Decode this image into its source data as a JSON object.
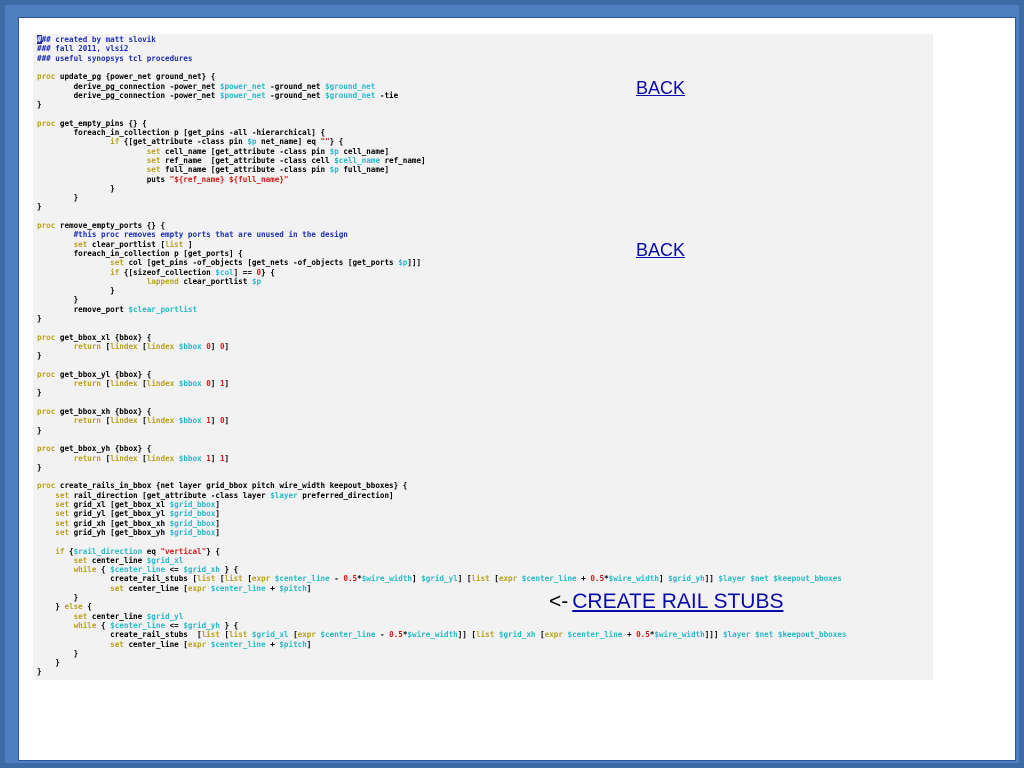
{
  "code": [
    [
      {
        "t": "#",
        "cls": "cursor"
      },
      {
        "t": "## created by matt slovik",
        "cls": "c"
      }
    ],
    [
      {
        "t": "### fall 2011, vlsi2",
        "cls": "c"
      }
    ],
    [
      {
        "t": "### useful synopsys tcl procedures",
        "cls": "c"
      }
    ],
    [],
    [
      {
        "t": "proc",
        "cls": "k"
      },
      {
        "t": " update_pg {power_net ground_net} {"
      }
    ],
    [
      {
        "t": "        derive_pg_connection -power_net "
      },
      {
        "t": "$power_net",
        "cls": "v"
      },
      {
        "t": " -ground_net "
      },
      {
        "t": "$ground_net",
        "cls": "v"
      }
    ],
    [
      {
        "t": "        derive_pg_connection -power_net "
      },
      {
        "t": "$power_net",
        "cls": "v"
      },
      {
        "t": " -ground_net "
      },
      {
        "t": "$ground_net",
        "cls": "v"
      },
      {
        "t": " -tie"
      }
    ],
    [
      {
        "t": "}"
      }
    ],
    [],
    [
      {
        "t": "proc",
        "cls": "k"
      },
      {
        "t": " get_empty_pins {} {"
      }
    ],
    [
      {
        "t": "        foreach_in_collection p [get_pins -all -hierarchical] {"
      }
    ],
    [
      {
        "t": "                "
      },
      {
        "t": "if",
        "cls": "k"
      },
      {
        "t": " {[get_attribute -class pin "
      },
      {
        "t": "$p",
        "cls": "v"
      },
      {
        "t": " net_name] eq "
      },
      {
        "t": "\"\"",
        "cls": "s"
      },
      {
        "t": "} {"
      }
    ],
    [
      {
        "t": "                        "
      },
      {
        "t": "set",
        "cls": "k"
      },
      {
        "t": " cell_name [get_attribute -class pin "
      },
      {
        "t": "$p",
        "cls": "v"
      },
      {
        "t": " cell_name]"
      }
    ],
    [
      {
        "t": "                        "
      },
      {
        "t": "set",
        "cls": "k"
      },
      {
        "t": " ref_name  [get_attribute -class cell "
      },
      {
        "t": "$cell_name",
        "cls": "v"
      },
      {
        "t": " ref_name]"
      }
    ],
    [
      {
        "t": "                        "
      },
      {
        "t": "set",
        "cls": "k"
      },
      {
        "t": " full_name [get_attribute -class pin "
      },
      {
        "t": "$p",
        "cls": "v"
      },
      {
        "t": " full_name]"
      }
    ],
    [
      {
        "t": "                        puts "
      },
      {
        "t": "\"${ref_name} ${full_name}\"",
        "cls": "s"
      }
    ],
    [
      {
        "t": "                }"
      }
    ],
    [
      {
        "t": "        }"
      }
    ],
    [
      {
        "t": "}"
      }
    ],
    [],
    [
      {
        "t": "proc",
        "cls": "k"
      },
      {
        "t": " remove_empty_ports {} {"
      }
    ],
    [
      {
        "t": "        #this proc removes empty ports that are unused in the design",
        "cls": "c"
      }
    ],
    [
      {
        "t": "        "
      },
      {
        "t": "set",
        "cls": "k"
      },
      {
        "t": " clear_portlist ["
      },
      {
        "t": "list",
        "cls": "k"
      },
      {
        "t": " ]"
      }
    ],
    [
      {
        "t": "        foreach_in_collection p [get_ports] {"
      }
    ],
    [
      {
        "t": "                "
      },
      {
        "t": "set",
        "cls": "k"
      },
      {
        "t": " col [get_pins -of_objects [get_nets -of_objects [get_ports "
      },
      {
        "t": "$p",
        "cls": "v"
      },
      {
        "t": "]]]"
      }
    ],
    [
      {
        "t": "                "
      },
      {
        "t": "if",
        "cls": "k"
      },
      {
        "t": " {[sizeof_collection "
      },
      {
        "t": "$col",
        "cls": "v"
      },
      {
        "t": "] == "
      },
      {
        "t": "0",
        "cls": "n"
      },
      {
        "t": "} {"
      }
    ],
    [
      {
        "t": "                        "
      },
      {
        "t": "lappend",
        "cls": "k"
      },
      {
        "t": " clear_portlist "
      },
      {
        "t": "$p",
        "cls": "v"
      }
    ],
    [
      {
        "t": "                }"
      }
    ],
    [
      {
        "t": "        }"
      }
    ],
    [
      {
        "t": "        remove_port "
      },
      {
        "t": "$clear_portlist",
        "cls": "v"
      }
    ],
    [
      {
        "t": "}"
      }
    ],
    [],
    [
      {
        "t": "proc",
        "cls": "k"
      },
      {
        "t": " get_bbox_xl {bbox} {"
      }
    ],
    [
      {
        "t": "        "
      },
      {
        "t": "return",
        "cls": "k"
      },
      {
        "t": " ["
      },
      {
        "t": "lindex",
        "cls": "k"
      },
      {
        "t": " ["
      },
      {
        "t": "lindex",
        "cls": "k"
      },
      {
        "t": " "
      },
      {
        "t": "$bbox",
        "cls": "v"
      },
      {
        "t": " "
      },
      {
        "t": "0",
        "cls": "n"
      },
      {
        "t": "] "
      },
      {
        "t": "0",
        "cls": "n"
      },
      {
        "t": "]"
      }
    ],
    [
      {
        "t": "}"
      }
    ],
    [],
    [
      {
        "t": "proc",
        "cls": "k"
      },
      {
        "t": " get_bbox_yl {bbox} {"
      }
    ],
    [
      {
        "t": "        "
      },
      {
        "t": "return",
        "cls": "k"
      },
      {
        "t": " ["
      },
      {
        "t": "lindex",
        "cls": "k"
      },
      {
        "t": " ["
      },
      {
        "t": "lindex",
        "cls": "k"
      },
      {
        "t": " "
      },
      {
        "t": "$bbox",
        "cls": "v"
      },
      {
        "t": " "
      },
      {
        "t": "0",
        "cls": "n"
      },
      {
        "t": "] "
      },
      {
        "t": "1",
        "cls": "n"
      },
      {
        "t": "]"
      }
    ],
    [
      {
        "t": "}"
      }
    ],
    [],
    [
      {
        "t": "proc",
        "cls": "k"
      },
      {
        "t": " get_bbox_xh {bbox} {"
      }
    ],
    [
      {
        "t": "        "
      },
      {
        "t": "return",
        "cls": "k"
      },
      {
        "t": " ["
      },
      {
        "t": "lindex",
        "cls": "k"
      },
      {
        "t": " ["
      },
      {
        "t": "lindex",
        "cls": "k"
      },
      {
        "t": " "
      },
      {
        "t": "$bbox",
        "cls": "v"
      },
      {
        "t": " "
      },
      {
        "t": "1",
        "cls": "n"
      },
      {
        "t": "] "
      },
      {
        "t": "0",
        "cls": "n"
      },
      {
        "t": "]"
      }
    ],
    [
      {
        "t": "}"
      }
    ],
    [],
    [
      {
        "t": "proc",
        "cls": "k"
      },
      {
        "t": " get_bbox_yh {bbox} {"
      }
    ],
    [
      {
        "t": "        "
      },
      {
        "t": "return",
        "cls": "k"
      },
      {
        "t": " ["
      },
      {
        "t": "lindex",
        "cls": "k"
      },
      {
        "t": " ["
      },
      {
        "t": "lindex",
        "cls": "k"
      },
      {
        "t": " "
      },
      {
        "t": "$bbox",
        "cls": "v"
      },
      {
        "t": " "
      },
      {
        "t": "1",
        "cls": "n"
      },
      {
        "t": "] "
      },
      {
        "t": "1",
        "cls": "n"
      },
      {
        "t": "]"
      }
    ],
    [
      {
        "t": "}"
      }
    ],
    [],
    [
      {
        "t": "proc",
        "cls": "k"
      },
      {
        "t": " create_rails_in_bbox {net layer grid_bbox pitch wire_width keepout_bboxes} {"
      }
    ],
    [
      {
        "t": "    "
      },
      {
        "t": "set",
        "cls": "k"
      },
      {
        "t": " rail_direction [get_attribute -class layer "
      },
      {
        "t": "$layer",
        "cls": "v"
      },
      {
        "t": " preferred_direction]"
      }
    ],
    [
      {
        "t": "    "
      },
      {
        "t": "set",
        "cls": "k"
      },
      {
        "t": " grid_xl [get_bbox_xl "
      },
      {
        "t": "$grid_bbox",
        "cls": "v"
      },
      {
        "t": "]"
      }
    ],
    [
      {
        "t": "    "
      },
      {
        "t": "set",
        "cls": "k"
      },
      {
        "t": " grid_yl [get_bbox_yl "
      },
      {
        "t": "$grid_bbox",
        "cls": "v"
      },
      {
        "t": "]"
      }
    ],
    [
      {
        "t": "    "
      },
      {
        "t": "set",
        "cls": "k"
      },
      {
        "t": " grid_xh [get_bbox_xh "
      },
      {
        "t": "$grid_bbox",
        "cls": "v"
      },
      {
        "t": "]"
      }
    ],
    [
      {
        "t": "    "
      },
      {
        "t": "set",
        "cls": "k"
      },
      {
        "t": " grid_yh [get_bbox_yh "
      },
      {
        "t": "$grid_bbox",
        "cls": "v"
      },
      {
        "t": "]"
      }
    ],
    [],
    [
      {
        "t": "    "
      },
      {
        "t": "if",
        "cls": "k"
      },
      {
        "t": " {"
      },
      {
        "t": "$rail_direction",
        "cls": "v"
      },
      {
        "t": " eq "
      },
      {
        "t": "\"vertical\"",
        "cls": "s"
      },
      {
        "t": "} {"
      }
    ],
    [
      {
        "t": "        "
      },
      {
        "t": "set",
        "cls": "k"
      },
      {
        "t": " center_line "
      },
      {
        "t": "$grid_xl",
        "cls": "v"
      }
    ],
    [
      {
        "t": "        "
      },
      {
        "t": "while",
        "cls": "k"
      },
      {
        "t": " { "
      },
      {
        "t": "$center_line",
        "cls": "v"
      },
      {
        "t": " <= "
      },
      {
        "t": "$grid_xh",
        "cls": "v"
      },
      {
        "t": " } {"
      }
    ],
    [
      {
        "t": "                create_rail_stubs ["
      },
      {
        "t": "list",
        "cls": "k"
      },
      {
        "t": " ["
      },
      {
        "t": "list",
        "cls": "k"
      },
      {
        "t": " ["
      },
      {
        "t": "expr",
        "cls": "k"
      },
      {
        "t": " "
      },
      {
        "t": "$center_line",
        "cls": "v"
      },
      {
        "t": " - "
      },
      {
        "t": "0.5",
        "cls": "n"
      },
      {
        "t": "*"
      },
      {
        "t": "$wire_width",
        "cls": "v"
      },
      {
        "t": "] "
      },
      {
        "t": "$grid_yl",
        "cls": "v"
      },
      {
        "t": "] ["
      },
      {
        "t": "list",
        "cls": "k"
      },
      {
        "t": " ["
      },
      {
        "t": "expr",
        "cls": "k"
      },
      {
        "t": " "
      },
      {
        "t": "$center_line",
        "cls": "v"
      },
      {
        "t": " + "
      },
      {
        "t": "0.5",
        "cls": "n"
      },
      {
        "t": "*"
      },
      {
        "t": "$wire_width",
        "cls": "v"
      },
      {
        "t": "] "
      },
      {
        "t": "$grid_yh",
        "cls": "v"
      },
      {
        "t": "]] "
      },
      {
        "t": "$layer",
        "cls": "v"
      },
      {
        "t": " "
      },
      {
        "t": "$net",
        "cls": "v"
      },
      {
        "t": " "
      },
      {
        "t": "$keepout_bboxes",
        "cls": "v"
      }
    ],
    [
      {
        "t": "                "
      },
      {
        "t": "set",
        "cls": "k"
      },
      {
        "t": " center_line ["
      },
      {
        "t": "expr",
        "cls": "k"
      },
      {
        "t": " "
      },
      {
        "t": "$center_line",
        "cls": "v"
      },
      {
        "t": " + "
      },
      {
        "t": "$pitch",
        "cls": "v"
      },
      {
        "t": "]"
      }
    ],
    [
      {
        "t": "        }"
      }
    ],
    [
      {
        "t": "    } "
      },
      {
        "t": "else",
        "cls": "k"
      },
      {
        "t": " {"
      }
    ],
    [
      {
        "t": "        "
      },
      {
        "t": "set",
        "cls": "k"
      },
      {
        "t": " center_line "
      },
      {
        "t": "$grid_yl",
        "cls": "v"
      }
    ],
    [
      {
        "t": "        "
      },
      {
        "t": "while",
        "cls": "k"
      },
      {
        "t": " { "
      },
      {
        "t": "$center_line",
        "cls": "v"
      },
      {
        "t": " <= "
      },
      {
        "t": "$grid_yh",
        "cls": "v"
      },
      {
        "t": " } {"
      }
    ],
    [
      {
        "t": "                create_rail_stubs  ["
      },
      {
        "t": "list",
        "cls": "k"
      },
      {
        "t": " ["
      },
      {
        "t": "list",
        "cls": "k"
      },
      {
        "t": " "
      },
      {
        "t": "$grid_xl",
        "cls": "v"
      },
      {
        "t": " ["
      },
      {
        "t": "expr",
        "cls": "k"
      },
      {
        "t": " "
      },
      {
        "t": "$center_line",
        "cls": "v"
      },
      {
        "t": " - "
      },
      {
        "t": "0.5",
        "cls": "n"
      },
      {
        "t": "*"
      },
      {
        "t": "$wire_width",
        "cls": "v"
      },
      {
        "t": "]] ["
      },
      {
        "t": "list",
        "cls": "k"
      },
      {
        "t": " "
      },
      {
        "t": "$grid_xh",
        "cls": "v"
      },
      {
        "t": " ["
      },
      {
        "t": "expr",
        "cls": "k"
      },
      {
        "t": " "
      },
      {
        "t": "$center_line",
        "cls": "v"
      },
      {
        "t": " + "
      },
      {
        "t": "0.5",
        "cls": "n"
      },
      {
        "t": "*"
      },
      {
        "t": "$wire_width",
        "cls": "v"
      },
      {
        "t": "]]] "
      },
      {
        "t": "$layer",
        "cls": "v"
      },
      {
        "t": " "
      },
      {
        "t": "$net",
        "cls": "v"
      },
      {
        "t": " "
      },
      {
        "t": "$keepout_bboxes",
        "cls": "v"
      }
    ],
    [
      {
        "t": "                "
      },
      {
        "t": "set",
        "cls": "k"
      },
      {
        "t": " center_line ["
      },
      {
        "t": "expr",
        "cls": "k"
      },
      {
        "t": " "
      },
      {
        "t": "$center_line",
        "cls": "v"
      },
      {
        "t": " + "
      },
      {
        "t": "$pitch",
        "cls": "v"
      },
      {
        "t": "]"
      }
    ],
    [
      {
        "t": "        }"
      }
    ],
    [
      {
        "t": "    }"
      }
    ],
    [
      {
        "t": "}"
      }
    ]
  ],
  "links": {
    "back_top": "BACK",
    "back_middle": "BACK",
    "rail_arrow": "<-",
    "rail_link": "CREATE  RAIL  STUBS"
  }
}
